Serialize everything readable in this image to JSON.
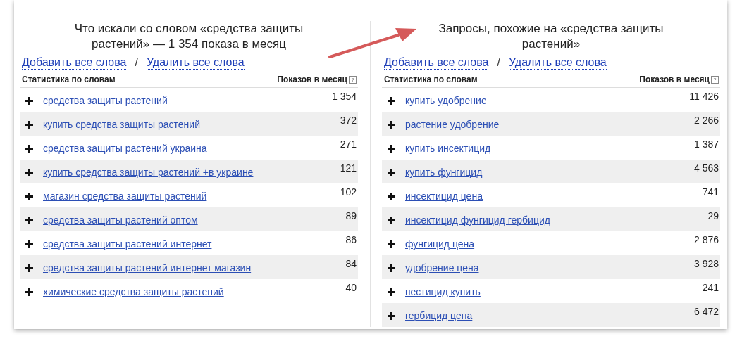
{
  "panels": [
    {
      "title": "Что искали со словом «средства защиты растений» — 1 354 показа в месяц",
      "add_all": "Добавить все слова",
      "separator": "/",
      "remove_all": "Удалить все слова",
      "column_keyword": "Статистика по словам",
      "column_count": "Показов в месяц",
      "help": "?",
      "rows": [
        {
          "keyword": "средства защиты растений",
          "count": "1 354"
        },
        {
          "keyword": "купить средства защиты растений",
          "count": "372"
        },
        {
          "keyword": "средства защиты растений украина",
          "count": "271"
        },
        {
          "keyword": "купить средства защиты растений +в украине",
          "count": "121"
        },
        {
          "keyword": "магазин средства защиты растений",
          "count": "102"
        },
        {
          "keyword": "средства защиты растений оптом",
          "count": "89"
        },
        {
          "keyword": "средства защиты растений интернет",
          "count": "86"
        },
        {
          "keyword": "средства защиты растений интернет магазин",
          "count": "84"
        },
        {
          "keyword": "химические средства защиты растений",
          "count": "40"
        }
      ]
    },
    {
      "title": "Запросы, похожие на «средства защиты растений»",
      "add_all": "Добавить все слова",
      "separator": "/",
      "remove_all": "Удалить все слова",
      "column_keyword": "Статистика по словам",
      "column_count": "Показов в месяц",
      "help": "?",
      "rows": [
        {
          "keyword": "купить удобрение",
          "count": "11 426"
        },
        {
          "keyword": "растение удобрение",
          "count": "2 266"
        },
        {
          "keyword": "купить инсектицид",
          "count": "1 387"
        },
        {
          "keyword": "купить фунгицид",
          "count": "4 563"
        },
        {
          "keyword": "инсектицид цена",
          "count": "741"
        },
        {
          "keyword": "инсектицид фунгицид гербицид",
          "count": "29"
        },
        {
          "keyword": "фунгицид цена",
          "count": "2 876"
        },
        {
          "keyword": "удобрение цена",
          "count": "3 928"
        },
        {
          "keyword": "пестицид купить",
          "count": "241"
        },
        {
          "keyword": "гербицид цена",
          "count": "6 472"
        }
      ]
    }
  ]
}
